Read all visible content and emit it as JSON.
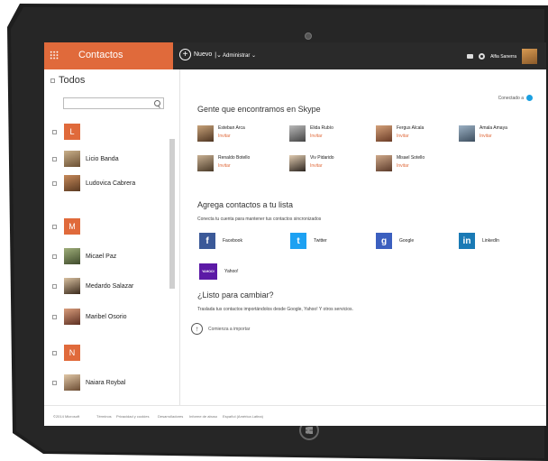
{
  "app": {
    "title": "Contactos",
    "new_label": "Nuevo",
    "admin_label": "Administrar",
    "user_name": "Alfia Sanerra"
  },
  "left": {
    "filter_label": "Todos",
    "search_placeholder": "",
    "contacts": [
      {
        "type": "letter",
        "text": "L"
      },
      {
        "type": "person",
        "name": "Licio Banda"
      },
      {
        "type": "person",
        "name": "Ludovica Cabrera"
      },
      {
        "type": "letter",
        "text": "M"
      },
      {
        "type": "person",
        "name": "Micael Paz"
      },
      {
        "type": "person",
        "name": "Medardo Salazar"
      },
      {
        "type": "person",
        "name": "Maribel Osorio"
      },
      {
        "type": "letter",
        "text": "N"
      },
      {
        "type": "person",
        "name": "Naiara Roybal"
      }
    ]
  },
  "main": {
    "connected_label": "Conectado a",
    "skype_heading": "Gente que encontramos en Skype",
    "invite_label": "Invitar",
    "people": [
      {
        "name": "Esteban Arca"
      },
      {
        "name": "Elida Rubío"
      },
      {
        "name": "Fergus Alcala"
      },
      {
        "name": "Amala Amaya"
      },
      {
        "name": "Renaldo Botello"
      },
      {
        "name": "Viv Pidarido"
      },
      {
        "name": "Misael Sotello"
      }
    ],
    "add_heading": "Agrega contactos a tu lista",
    "add_sub": "Conecta tu cuenta para mantener tus contactos sincronizados",
    "services": [
      {
        "name": "Facebook",
        "icon": "facebook-icon",
        "color": "#3b5998",
        "glyph": "f"
      },
      {
        "name": "Twitter",
        "icon": "twitter-icon",
        "color": "#1da1f2",
        "glyph": "t"
      },
      {
        "name": "Google",
        "icon": "google-icon",
        "color": "#3b5fbf",
        "glyph": "g"
      },
      {
        "name": "LinkedIn",
        "icon": "linkedin-icon",
        "color": "#1a7ab5",
        "glyph": "in"
      },
      {
        "name": "Yahoo!",
        "icon": "yahoo-icon",
        "color": "#5c1aa6",
        "glyph": "YAHOO!"
      }
    ],
    "change_heading": "¿Listo para cambiar?",
    "change_sub": "Traslada tus contactos importándolos desde Google, Yahoo! Y otros servicios.",
    "import_label": "Comienza a importar"
  },
  "footer": {
    "copyright": "©2014 Microsoft",
    "links": [
      "Términos",
      "Privacidad y cookies",
      "Desarrolladores",
      "Informe de abuso",
      "Español (América Latina)"
    ]
  },
  "colors": {
    "accent": "#e06a3b",
    "topbar": "#2a2a2a",
    "frame": "#1e1e1e"
  }
}
